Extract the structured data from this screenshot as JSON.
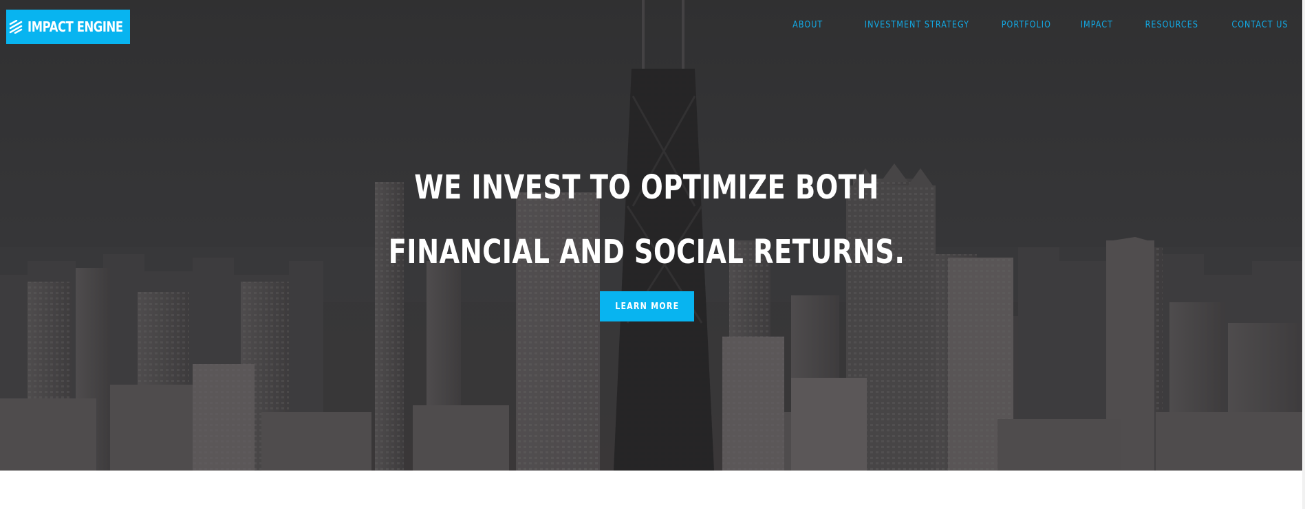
{
  "brand": {
    "name": "IMPACT ENGINE",
    "logo_icon": "stacked-slashes-icon",
    "color": "#08b4f0"
  },
  "nav": {
    "items": [
      {
        "label": "ABOUT"
      },
      {
        "label": "INVESTMENT STRATEGY"
      },
      {
        "label": "PORTFOLIO"
      },
      {
        "label": "IMPACT"
      },
      {
        "label": "RESOURCES"
      },
      {
        "label": "CONTACT US"
      }
    ],
    "color": "#12a9e4"
  },
  "hero": {
    "headline_line1": "WE INVEST TO OPTIMIZE BOTH",
    "headline_line2": "FINANCIAL AND SOCIAL RETURNS.",
    "cta_label": "LEARN MORE",
    "background": "city-skyline-photo"
  }
}
